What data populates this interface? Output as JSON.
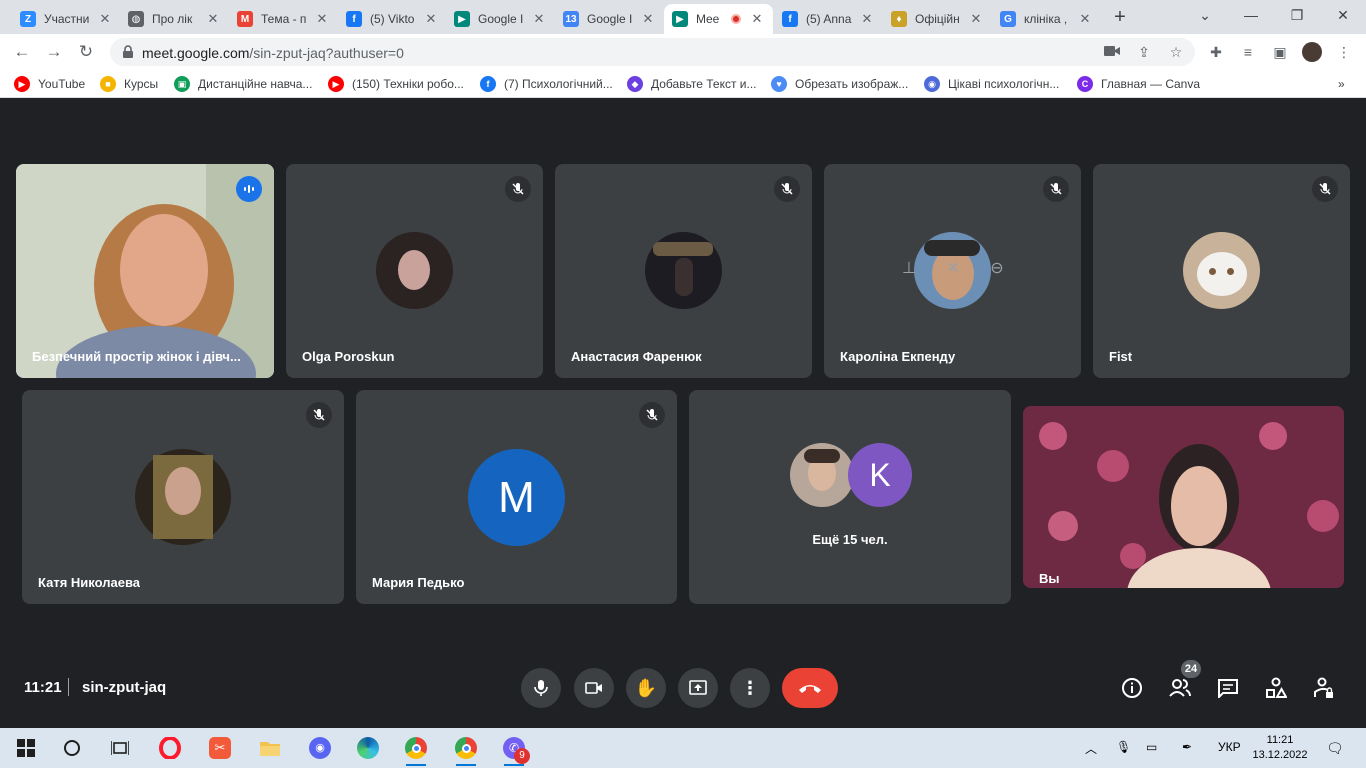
{
  "browser": {
    "tabs": [
      {
        "label": "Участни",
        "icon": "zoom-icon",
        "color": "#2d8cff",
        "glyph": "Z"
      },
      {
        "label": "Про лік",
        "icon": "globe-icon",
        "color": "#5f6368",
        "glyph": "◍"
      },
      {
        "label": "Тема - п",
        "icon": "gmail-icon",
        "color": "#ea4335",
        "glyph": "M"
      },
      {
        "label": "(5) Vikto",
        "icon": "facebook-icon",
        "color": "#1877f2",
        "glyph": "f"
      },
      {
        "label": "Google I",
        "icon": "meet-icon",
        "color": "#00897b",
        "glyph": "▶"
      },
      {
        "label": "Google I",
        "icon": "calendar-icon",
        "color": "#4285f4",
        "glyph": "13"
      },
      {
        "label": "Mee",
        "icon": "meet-icon",
        "color": "#00897b",
        "glyph": "▶",
        "recording": true
      },
      {
        "label": "(5) Anna",
        "icon": "facebook-icon",
        "color": "#1877f2",
        "glyph": "f"
      },
      {
        "label": "Офіційн",
        "icon": "crest-icon",
        "color": "#c9a227",
        "glyph": "♦"
      },
      {
        "label": "клініка ,",
        "icon": "google-icon",
        "color": "#4285f4",
        "glyph": "G"
      }
    ],
    "url_host": "meet.google.com",
    "url_path": "/sin-zput-jaq?authuser=0",
    "bookmarks": [
      {
        "label": "YouTube",
        "icon": "youtube-icon",
        "color": "#ff0000",
        "glyph": "▶"
      },
      {
        "label": "Курсы",
        "icon": "classroom-icon",
        "color": "#f4b400",
        "glyph": "■"
      },
      {
        "label": "Дистанційне навча...",
        "icon": "classroom-icon",
        "color": "#0f9d58",
        "glyph": "▣"
      },
      {
        "label": "(150) Техніки робо...",
        "icon": "youtube-icon",
        "color": "#ff0000",
        "glyph": "▶"
      },
      {
        "label": "(7) Психологічний...",
        "icon": "facebook-icon",
        "color": "#1877f2",
        "glyph": "f"
      },
      {
        "label": "Добавьте Текст и...",
        "icon": "shield-icon",
        "color": "#6c3fe0",
        "glyph": "◆"
      },
      {
        "label": "Обрезать изображ...",
        "icon": "heart-icon",
        "color": "#4d8cf5",
        "glyph": "♥"
      },
      {
        "label": "Цікаві психологічн...",
        "icon": "browser-icon",
        "color": "#4d6bd8",
        "glyph": "◉"
      },
      {
        "label": "Главная — Canva",
        "icon": "canva-icon",
        "color": "#7d2ae8",
        "glyph": "C"
      }
    ]
  },
  "meet": {
    "participants_row1": [
      {
        "name": "Безпечний простір жінок і дівч...",
        "type": "video",
        "speaking": true
      },
      {
        "name": "Olga Poroskun",
        "type": "photo",
        "muted": true,
        "avatar_color": "#2b2222"
      },
      {
        "name": "Анастасия Фаренюк",
        "type": "photo",
        "muted": true,
        "avatar_color": "#1c1c22"
      },
      {
        "name": "Кароліна Екпенду",
        "type": "photo",
        "muted": true,
        "avatar_color": "#6b8fb5",
        "hover": true
      },
      {
        "name": "Fist",
        "type": "photo",
        "muted": true,
        "avatar_color": "#c9b29a"
      }
    ],
    "participants_row2": [
      {
        "name": "Катя Николаева",
        "type": "photo",
        "muted": true,
        "avatar_color": "#6a5a3a"
      },
      {
        "name": "Мария Педько",
        "type": "letter",
        "muted": true,
        "letter": "M",
        "avatar_color": "#1565c0"
      },
      {
        "name": "",
        "type": "more",
        "more_label": "Ещё 15 чел.",
        "letter": "K",
        "letter_color": "#7e57c2",
        "photo_color": "#b7a79a"
      },
      {
        "name": "Вы",
        "type": "self"
      }
    ],
    "time": "11:21",
    "meeting_code": "sin-zput-jaq",
    "participant_count": "24",
    "colors": {
      "background": "#202124",
      "tile": "#3c4043",
      "end_call": "#ea4335",
      "speaking": "#8ab4f8"
    }
  },
  "taskbar": {
    "language": "УКР",
    "time": "11:21",
    "date": "13.12.2022",
    "viber_badge": "9"
  }
}
